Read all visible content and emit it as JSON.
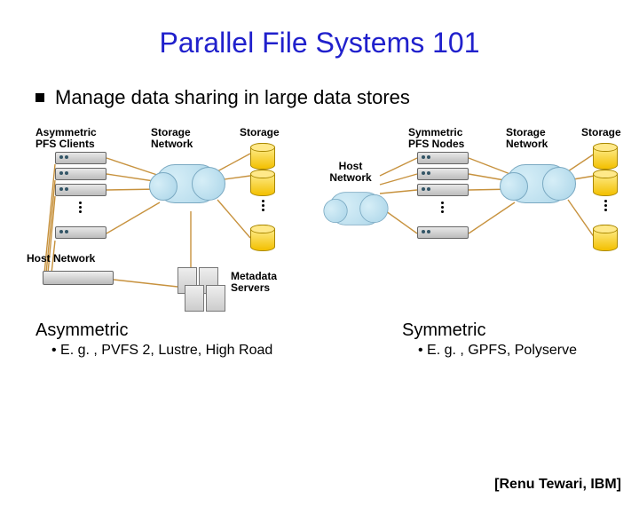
{
  "title": "Parallel File Systems 101",
  "bullet": "Manage data sharing in large data stores",
  "left": {
    "clients_label": "Asymmetric\nPFS Clients",
    "storage_net_label": "Storage\nNetwork",
    "storage_label": "Storage",
    "host_net_label": "Host Network",
    "metadata_label": "Metadata\nServers",
    "caption": "Asymmetric",
    "examples": "E. g. , PVFS 2, Lustre, High Road"
  },
  "right": {
    "host_net_label": "Host\nNetwork",
    "clients_label": "Symmetric\nPFS Nodes",
    "storage_net_label": "Storage\nNetwork",
    "storage_label": "Storage",
    "caption": "Symmetric",
    "examples": "E. g. , GPFS, Polyserve"
  },
  "credit": "[Renu Tewari, IBM]"
}
